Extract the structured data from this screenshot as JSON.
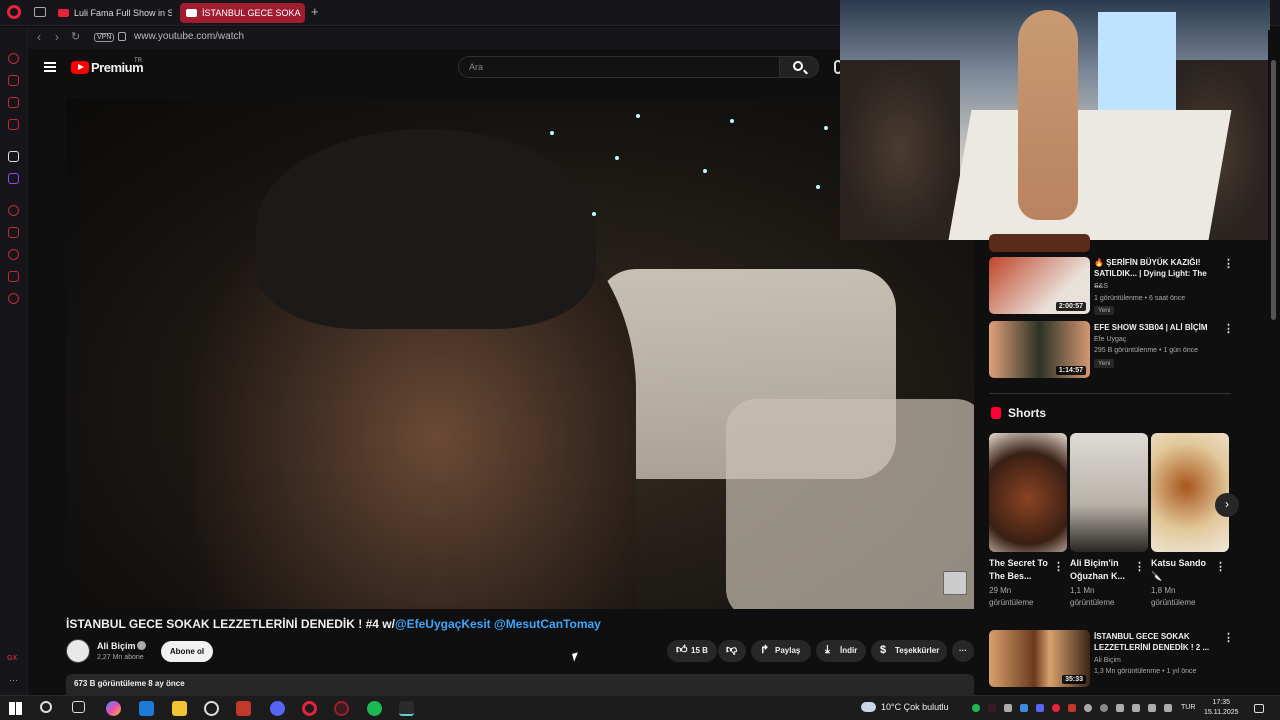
{
  "browser": {
    "tabs": [
      {
        "label": "Luli Fama Full Show in SLO"
      },
      {
        "label": "İSTANBUL GECE SOKA"
      }
    ],
    "url": "www.youtube.com/watch",
    "vpn_label": "VPN",
    "sidebar_gx": "GX"
  },
  "youtube": {
    "logo": "Premium",
    "region": "TR",
    "search_placeholder": "Ara"
  },
  "video": {
    "title": "İSTANBUL GECE SOKAK LEZZETLERİNİ DENEDİK ! #4 w/",
    "mention1": "@EfeUygaçKesit",
    "mention2": "@MesutCanTomay",
    "channel": "Ali Biçim",
    "subscribers": "2,27 Mn abone",
    "subscribe_label": "Abone ol",
    "likes": "15 B",
    "share_label": "Paylaş",
    "download_label": "İndir",
    "thanks_label": "Teşekkürler",
    "views_line": "673 B görüntüleme  8 ay önce"
  },
  "recommended": [
    {
      "title": "🔥 ŞERİFİN BÜYÜK KAZIĞI! SATILDIK... | Dying Light: The ...",
      "channel": "S&S",
      "meta": "1 görüntülenme • 6 saat önce",
      "badge": "Yeni",
      "duration": "2:00:57",
      "thumb_color": "#b23a1f"
    },
    {
      "title": "EFE SHOW S3B04 | ALİ BİÇİM",
      "channel": "Efe Uygaç",
      "meta": "295 B görüntülenme • 1 gün önce",
      "badge": "Yeni",
      "duration": "1:14:57",
      "thumb_color": "#2e3b2a"
    },
    {
      "title": "İSTANBUL GECE SOKAK LEZZETLERİNİ DENEDİK ! 2 ...",
      "channel": "Ali Biçim",
      "meta": "1,3 Mn görüntülenme • 1 yıl önce",
      "duration": "35:33",
      "thumb_color": "#6a3a1c"
    }
  ],
  "shorts": {
    "label": "Shorts",
    "items": [
      {
        "title": "The Secret To The Bes...",
        "views": "29 Mn görüntüleme",
        "color": "#5a2d1a"
      },
      {
        "title": "Ali Biçim'in Oğuzhan K...",
        "views": "1,1 Mn görüntüleme",
        "color": "#c8c3bd"
      },
      {
        "title": "Katsu Sando 🔪",
        "views": "1,8 Mn görüntüleme",
        "color": "#b0662a"
      }
    ]
  },
  "taskbar": {
    "weather": "10°C  Çok bulutlu",
    "lang": "TUR",
    "time": "17:35",
    "date": "15.11.2025"
  }
}
